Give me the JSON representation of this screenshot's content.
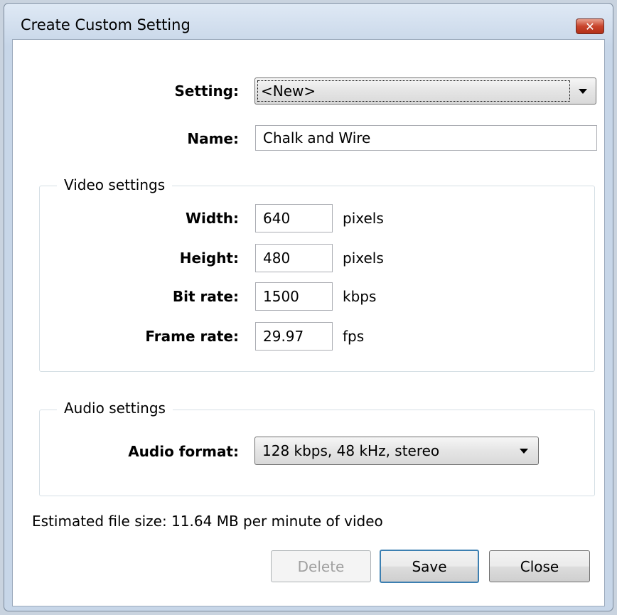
{
  "window": {
    "title": "Create Custom Setting",
    "close_icon": "✕"
  },
  "setting": {
    "label": "Setting:",
    "value": "<New>"
  },
  "name": {
    "label": "Name:",
    "value": "Chalk and Wire"
  },
  "video_settings": {
    "legend": "Video settings",
    "fields": [
      {
        "label": "Width:",
        "value": "640",
        "unit": "pixels"
      },
      {
        "label": "Height:",
        "value": "480",
        "unit": "pixels"
      },
      {
        "label": "Bit rate:",
        "value": "1500",
        "unit": "kbps"
      },
      {
        "label": "Frame rate:",
        "value": "29.97",
        "unit": "fps"
      }
    ]
  },
  "audio_settings": {
    "legend": "Audio settings",
    "format_label": "Audio format:",
    "format_value": "128 kbps, 48 kHz, stereo"
  },
  "estimate": "Estimated file size: 11.64 MB per minute of video",
  "buttons": {
    "delete": "Delete",
    "save": "Save",
    "close": "Close"
  },
  "colors": {
    "close_button": "#c8442c",
    "default_button_border": "#3c7fb1"
  }
}
